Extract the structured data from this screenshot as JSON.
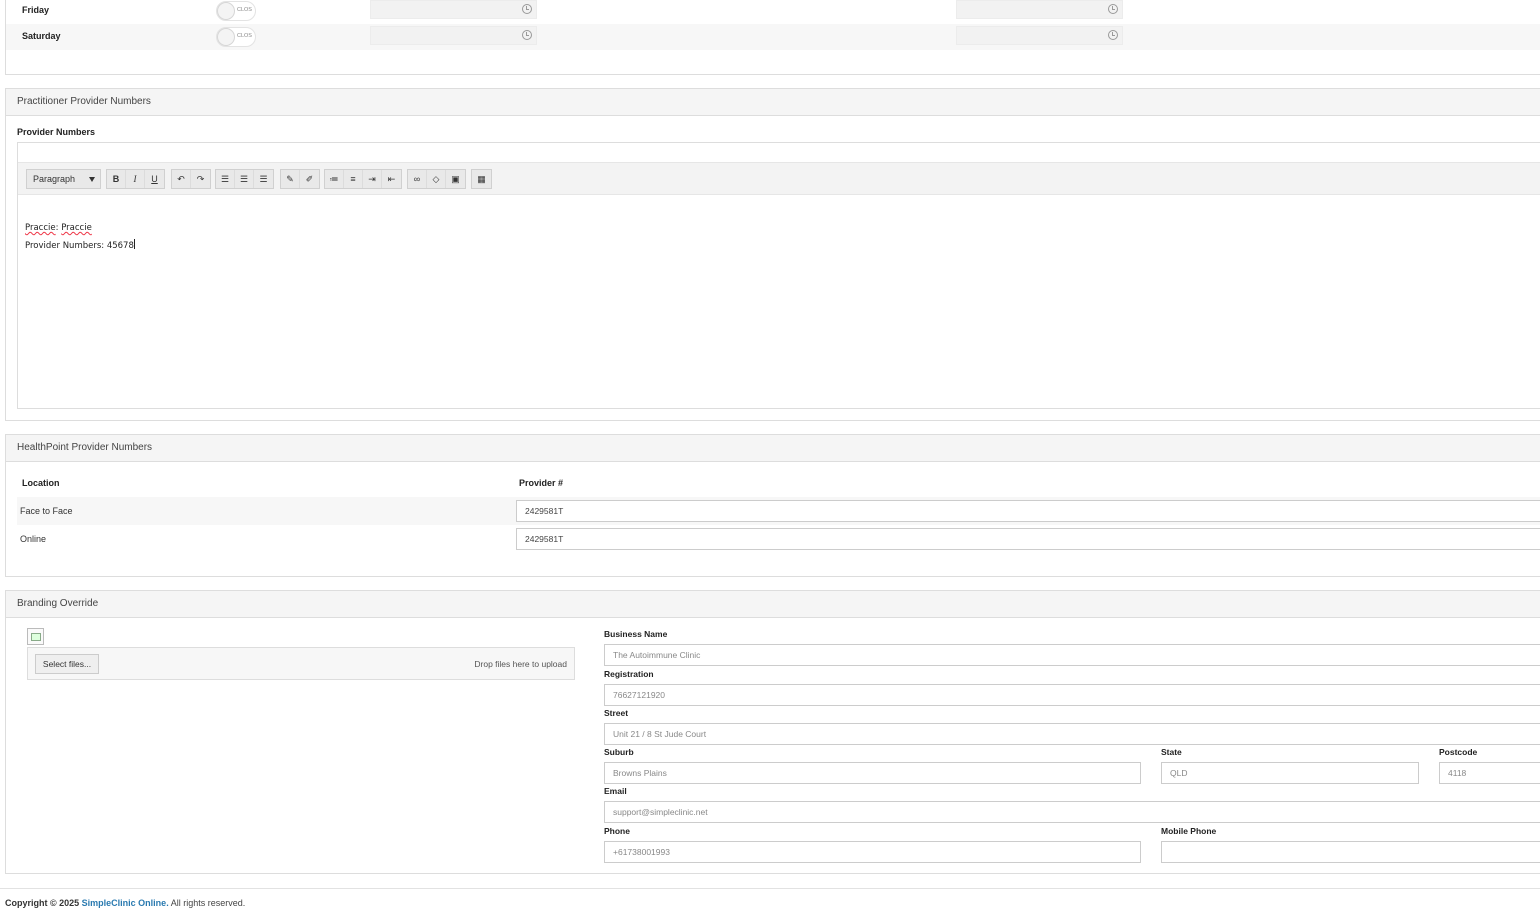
{
  "hours": {
    "rows": [
      {
        "day": "Friday",
        "toggle_text": "CLOS"
      },
      {
        "day": "Saturday",
        "toggle_text": "CLOS"
      }
    ]
  },
  "practitioner": {
    "title": "Practitioner Provider Numbers",
    "field_label": "Provider Numbers",
    "toolbar": {
      "format_select": "Paragraph",
      "bold": "B",
      "italic": "I",
      "underline": "U",
      "icons": [
        "undo-icon",
        "redo-icon",
        "align-left-icon",
        "align-center-icon",
        "align-right-icon",
        "clear-format-icon",
        "format-painter-icon",
        "bullet-list-icon",
        "numbered-list-icon",
        "indent-icon",
        "outdent-icon",
        "link-icon",
        "unlink-icon",
        "image-icon",
        "table-icon"
      ]
    },
    "content": {
      "line1_label": "Praccie",
      "line1_sep": ": ",
      "line1_value": "Praccie",
      "line2": "Provider Numbers: 45678"
    }
  },
  "healthpoint": {
    "title": "HealthPoint Provider Numbers",
    "columns": [
      "Location",
      "Provider #"
    ],
    "rows": [
      {
        "location": "Face to Face",
        "provider": "2429581T"
      },
      {
        "location": "Online",
        "provider": "2429581T"
      }
    ]
  },
  "branding": {
    "title": "Branding Override",
    "select_files": "Select files...",
    "drop_text": "Drop files here to upload",
    "business_name": {
      "label": "Business Name",
      "placeholder": "The Autoimmune Clinic"
    },
    "registration": {
      "label": "Registration",
      "placeholder": "76627121920"
    },
    "street": {
      "label": "Street",
      "placeholder": "Unit 21 / 8 St Jude Court"
    },
    "suburb": {
      "label": "Suburb",
      "placeholder": "Browns Plains"
    },
    "state": {
      "label": "State",
      "placeholder": "QLD"
    },
    "postcode": {
      "label": "Postcode",
      "placeholder": "4118"
    },
    "email": {
      "label": "Email",
      "placeholder": "support@simpleclinic.net"
    },
    "phone": {
      "label": "Phone",
      "placeholder": "+61738001993"
    },
    "mobile": {
      "label": "Mobile Phone",
      "placeholder": ""
    }
  },
  "footer": {
    "copyright": "Copyright © 2025",
    "brand": "SimpleClinic Online.",
    "rights": "All rights reserved."
  },
  "colors": {
    "link": "#2a7ab0",
    "panel_header": "#f5f5f5",
    "border": "#dddddd"
  }
}
